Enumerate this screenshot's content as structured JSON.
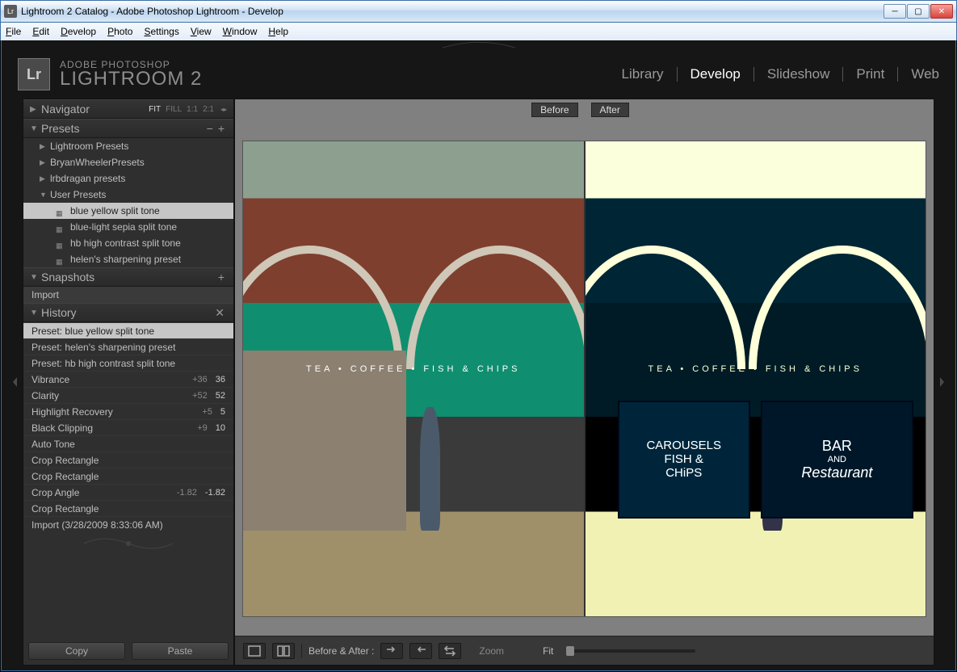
{
  "window": {
    "title": "Lightroom 2 Catalog - Adobe Photoshop Lightroom - Develop",
    "app_icon_label": "Lr"
  },
  "menubar": [
    "File",
    "Edit",
    "Develop",
    "Photo",
    "Settings",
    "View",
    "Window",
    "Help"
  ],
  "brand": {
    "logo": "Lr",
    "line1": "ADOBE PHOTOSHOP",
    "line2": "LIGHTROOM 2"
  },
  "modules": [
    {
      "label": "Library",
      "active": false
    },
    {
      "label": "Develop",
      "active": true
    },
    {
      "label": "Slideshow",
      "active": false
    },
    {
      "label": "Print",
      "active": false
    },
    {
      "label": "Web",
      "active": false
    }
  ],
  "navigator": {
    "title": "Navigator",
    "opts": [
      "FIT",
      "FILL",
      "1:1",
      "2:1"
    ],
    "selected": "FIT"
  },
  "presets": {
    "title": "Presets",
    "folders": [
      {
        "label": "Lightroom Presets",
        "open": false,
        "children": []
      },
      {
        "label": "BryanWheelerPresets",
        "open": false,
        "children": []
      },
      {
        "label": "lrbdragan presets",
        "open": false,
        "children": []
      },
      {
        "label": "User Presets",
        "open": true,
        "children": [
          {
            "label": "blue yellow split tone",
            "selected": true
          },
          {
            "label": "blue-light sepia split tone",
            "selected": false
          },
          {
            "label": "hb high contrast split tone",
            "selected": false
          },
          {
            "label": "helen's sharpening preset",
            "selected": false
          }
        ]
      }
    ]
  },
  "snapshots": {
    "title": "Snapshots",
    "items": [
      "Import"
    ]
  },
  "history": {
    "title": "History",
    "steps": [
      {
        "label": "Preset: blue yellow split tone",
        "selected": true
      },
      {
        "label": "Preset: helen's sharpening preset"
      },
      {
        "label": "Preset: hb high contrast split tone"
      },
      {
        "label": "Vibrance",
        "delta": "+36",
        "value": "36"
      },
      {
        "label": "Clarity",
        "delta": "+52",
        "value": "52"
      },
      {
        "label": "Highlight Recovery",
        "delta": "+5",
        "value": "5"
      },
      {
        "label": "Black Clipping",
        "delta": "+9",
        "value": "10"
      },
      {
        "label": "Auto Tone"
      },
      {
        "label": "Crop Rectangle"
      },
      {
        "label": "Crop Rectangle"
      },
      {
        "label": "Crop Angle",
        "delta": "-1.82",
        "value": "-1.82"
      },
      {
        "label": "Crop Rectangle"
      },
      {
        "label": "Import (3/28/2009 8:33:06 AM)"
      }
    ]
  },
  "left_buttons": {
    "copy": "Copy",
    "paste": "Paste"
  },
  "compare": {
    "before": "Before",
    "after": "After"
  },
  "photo_signs": {
    "storetext": "TEA   •   COFFEE   •   FISH & CHIPS",
    "sign1_l1": "CAROUSELS",
    "sign1_l2": "FISH &",
    "sign1_l3": "CHiPS",
    "sign2_l1": "BAR",
    "sign2_l2": "AND",
    "sign2_l3": "Restaurant"
  },
  "toolbar": {
    "ba_label": "Before & After :",
    "zoom_label": "Zoom",
    "fit_label": "Fit"
  }
}
